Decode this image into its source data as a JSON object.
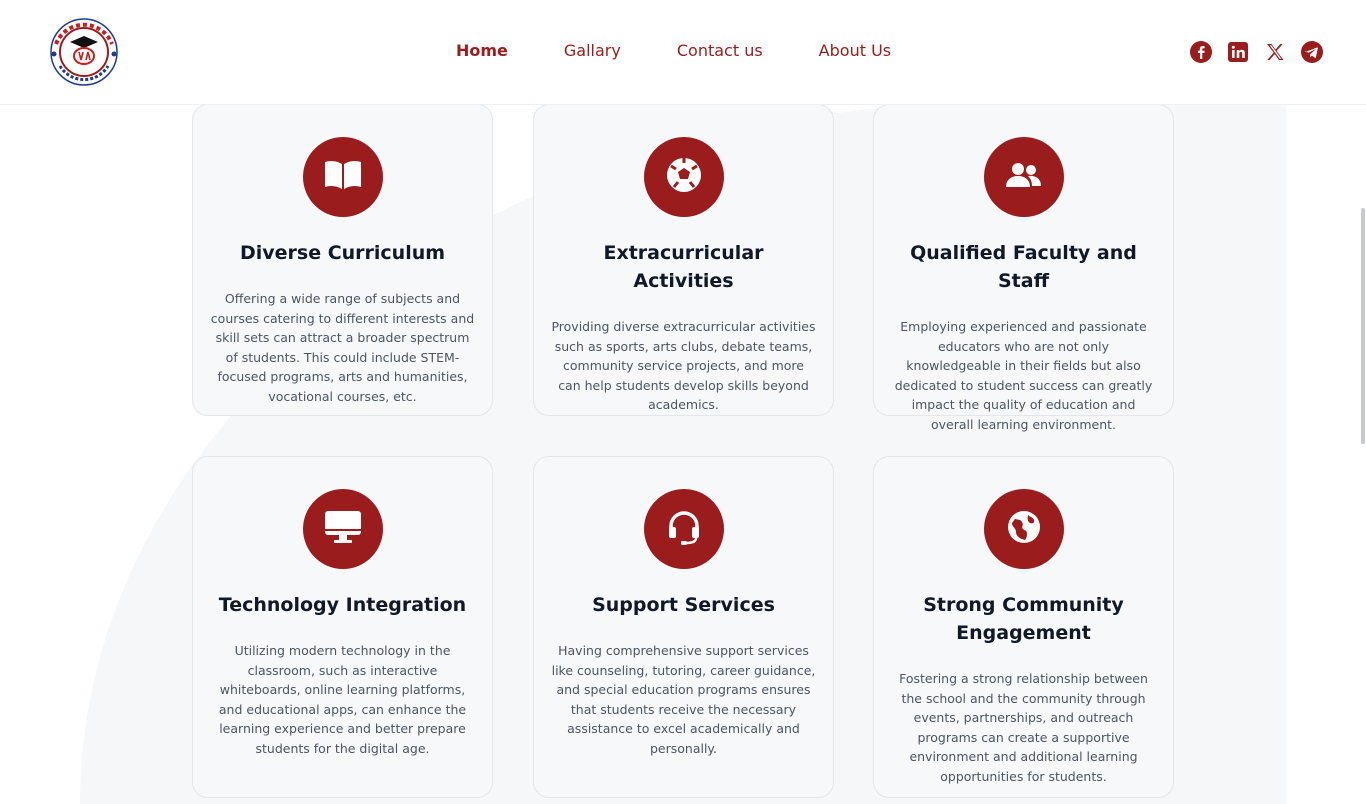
{
  "nav": {
    "home": "Home",
    "gallery": "Gallary",
    "contact": "Contact us",
    "about": "About Us"
  },
  "social": [
    "facebook-icon",
    "linkedin-icon",
    "x-icon",
    "telegram-icon"
  ],
  "colors": {
    "accent": "#9b1c1c",
    "card_bg": "#f7f8fa"
  },
  "cards": [
    {
      "icon": "book-open-icon",
      "title": "Diverse Curriculum",
      "text": "Offering a wide range of subjects and courses catering to different interests and skill sets can attract a broader spectrum of students. This could include STEM-focused programs, arts and humanities, vocational courses, etc."
    },
    {
      "icon": "soccer-ball-icon",
      "title": "Extracurricular Activities",
      "text": "Providing diverse extracurricular activities such as sports, arts clubs, debate teams, community service projects, and more can help students develop skills beyond academics."
    },
    {
      "icon": "users-icon",
      "title": "Qualified Faculty and Staff",
      "text": "Employing experienced and passionate educators who are not only knowledgeable in their fields but also dedicated to student success can greatly impact the quality of education and overall learning environment."
    },
    {
      "icon": "monitor-icon",
      "title": "Technology Integration",
      "text": "Utilizing modern technology in the classroom, such as interactive whiteboards, online learning platforms, and educational apps, can enhance the learning experience and better prepare students for the digital age."
    },
    {
      "icon": "headset-icon",
      "title": "Support Services",
      "text": "Having comprehensive support services like counseling, tutoring, career guidance, and special education programs ensures that students receive the necessary assistance to excel academically and personally."
    },
    {
      "icon": "globe-icon",
      "title": "Strong Community Engagement",
      "text": "Fostering a strong relationship between the school and the community through events, partnerships, and outreach programs can create a supportive environment and additional learning opportunities for students."
    }
  ]
}
